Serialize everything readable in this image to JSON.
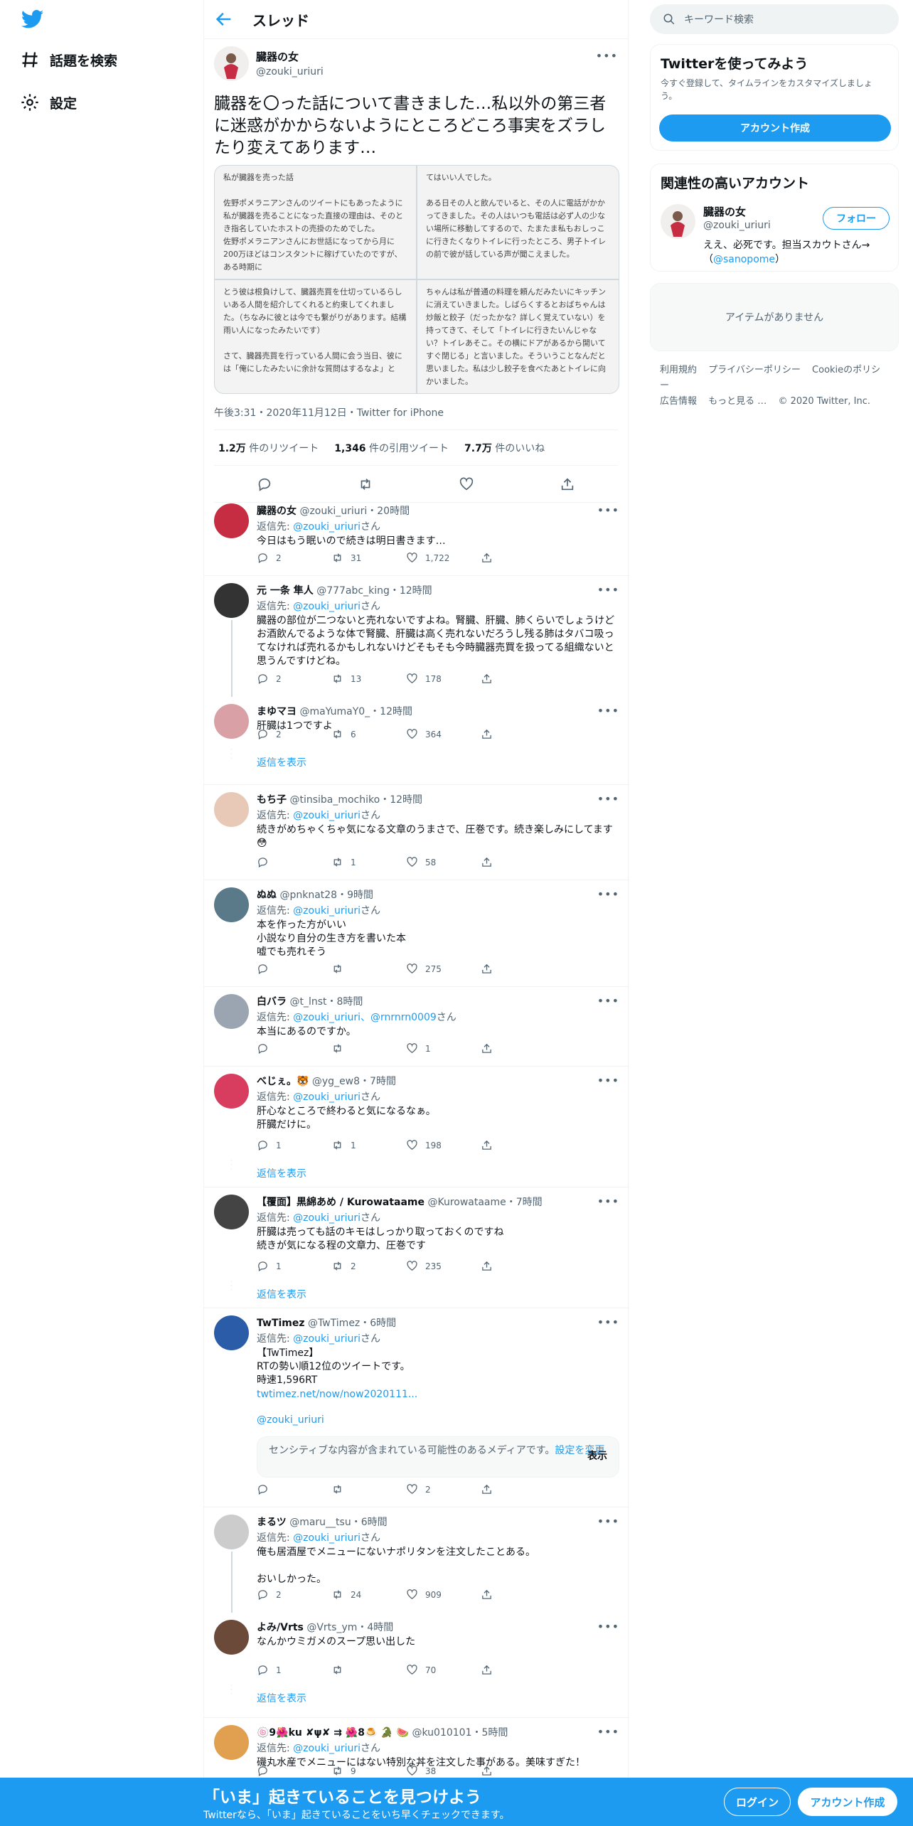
{
  "nav": {
    "explore": "話題を検索",
    "settings": "設定"
  },
  "header": {
    "title": "スレッド"
  },
  "main_tweet": {
    "name": "臓器の女",
    "handle": "@zouki_uriuri",
    "text": "臓器を〇った話について書きました…私以外の第三者に迷惑がかからないようにところどころ事実をズラしたり変えてあります…",
    "panels": [
      "私が臓器を売った話\n\n佐野ポメラニアンさんのツイートにもあったように私が臓器を売ることになった直接の理由は、そのとき指名していたホストの売掛のためでした。\n佐野ポメラニアンさんにお世話になってから月に200万ほどはコンスタントに稼げていたのですが、ある時期に",
      "てはいい人でした。\n\nある日その人と飲んでいると、その人に電話がかかってきました。その人はいつも電話は必ず人の少ない場所に移動してするので、たまたま私もおしっこに行きたくなりトイレに行ったところ、男子トイレの前で彼が話している声が聞こえました。",
      "とう彼は根負けして、臓器売買を仕切っているらしいある人間を紹介してくれると約束してくれました。（ちなみに彼とは今でも繋がりがあります。結構雨い人になったみたいです）\n\nさて、臓器売買を行っている人間に会う当日、彼には「俺にしたみたいに余計な質問はするなよ」と",
      "ちゃんは私が普通の料理を頼んだみたいにキッチンに消えていきました。しばらくするとおばちゃんは炒飯と餃子（だったかな？詳しく覚えていない）を持ってきて、そして「トイレに行きたいんじゃない？トイレあそこ。その横にドアがあるから開いてすぐ閉じる」と言いました。そういうことなんだと思いました。私は少し餃子を食べたあとトイレに向かいました。"
    ],
    "meta": "午後3:31・2020年11月12日・Twitter for iPhone",
    "retweets": "1.2万",
    "retweets_label": "件のリツイート",
    "quotes": "1,346",
    "quotes_label": "件の引用ツイート",
    "likes": "7.7万",
    "likes_label": "件のいいね"
  },
  "replies": [
    {
      "name": "臓器の女",
      "handle": "@zouki_uriuri・20時間",
      "to": "@zouki_uriuri",
      "text": "今日はもう眠いので続きは明日書きます…",
      "reply": "2",
      "rt": "31",
      "like": "1,722"
    },
    {
      "name": "元 一条 隼人",
      "handle": "@777abc_king・12時間",
      "to": "@zouki_uriuri",
      "text": "臓器の部位が二つないと売れないですよね。腎臓、肝臓、肺くらいでしょうけどお酒飲んでるような体で腎臓、肝臓は高く売れないだろうし残る肺はタバコ吸ってなければ売れるかもしれないけどそもそも今時臓器売買を扱ってる組織ないと思うんですけどね。",
      "reply": "2",
      "rt": "13",
      "like": "178"
    },
    {
      "name": "まゆマヨ",
      "handle": "@maYumaY0_・12時間",
      "to": "",
      "text": "肝臓は1つですよ",
      "reply": "2",
      "rt": "6",
      "like": "364"
    },
    {
      "name": "もち子",
      "handle": "@tinsiba_mochiko・12時間",
      "to": "@zouki_uriuri",
      "text": "続きがめちゃくちゃ気になる文章のうまさで、圧巻です。続き楽しみにしてます😳",
      "reply": "",
      "rt": "1",
      "like": "58"
    },
    {
      "name": "ぬぬ",
      "handle": "@pnknat28・9時間",
      "to": "@zouki_uriuri",
      "text": "本を作った方がいい\n小説なり自分の生き方を書いた本\n嘘でも売れそう",
      "reply": "",
      "rt": "",
      "like": "275"
    },
    {
      "name": "白バラ",
      "handle": "@t_lnst・8時間",
      "to": "@zouki_uriuri、@rnrnrn0009",
      "text": "本当にあるのですか。",
      "reply": "",
      "rt": "",
      "like": "1"
    },
    {
      "name": "べじぇ。🐯",
      "handle": "@yg_ew8・7時間",
      "to": "@zouki_uriuri",
      "text": "肝心なところで終わると気になるなぁ。\n肝臓だけに。",
      "reply": "1",
      "rt": "1",
      "like": "198"
    },
    {
      "name": "【覆面】黒綿あめ / Kurowataame",
      "handle": "@Kurowataame・7時間",
      "to": "@zouki_uriuri",
      "text": "肝臓は売っても話のキモはしっかり取っておくのですね\n続きが気になる程の文章力、圧巻です",
      "reply": "1",
      "rt": "2",
      "like": "235"
    },
    {
      "name": "TwTimez",
      "handle": "@TwTimez・6時間",
      "to": "@zouki_uriuri",
      "text": "【TwTimez】\nRTの勢い順12位のツイートです。\n時速1,596RT",
      "link": "twtimez.net/now/now2020111...",
      "mention": "@zouki_uriuri",
      "reply": "",
      "rt": "",
      "like": "2"
    },
    {
      "name": "まるツ",
      "handle": "@maru__tsu・6時間",
      "to": "@zouki_uriuri",
      "text": "俺も居酒屋でメニューにないナポリタンを注文したことある。\n\nおいしかった。",
      "reply": "2",
      "rt": "24",
      "like": "909"
    },
    {
      "name": "よみ/Vrts",
      "handle": "@Vrts_ym・4時間",
      "to": "",
      "text": "なんかウミガメのスープ思い出した",
      "reply": "1",
      "rt": "",
      "like": "70"
    },
    {
      "name": "🍥9🌺ku ✘ψ✘ ⇉ 🌺8🍮 🐊 🍉",
      "handle": "@ku010101・5時間",
      "to": "@zouki_uriuri",
      "text": "磯丸水産でメニューにはない特別な丼を注文した事がある。美味すぎた！",
      "reply": "",
      "rt": "9",
      "like": "38"
    }
  ],
  "reply_to_prefix": "返信先: ",
  "reply_to_suffix": "さん",
  "show_replies": "返信を表示",
  "sensitive": {
    "text": "センシティブな内容が含まれている可能性のあるメディアです。",
    "change": "設定を変更",
    "show": "表示"
  },
  "right": {
    "search_placeholder": "キーワード検索",
    "signup_box": {
      "title": "Twitterを使ってみよう",
      "sub": "今すぐ登録して、タイムラインをカスタマイズしましょう。",
      "button": "アカウント作成"
    },
    "related": {
      "title": "関連性の高いアカウント",
      "name": "臓器の女",
      "handle": "@zouki_uriuri",
      "follow": "フォロー",
      "bio": "ええ、必死です。担当スカウトさん→（",
      "bio_link": "@sanopome",
      "bio_end": "）"
    },
    "empty": "アイテムがありません",
    "footer": [
      "利用規約",
      "プライバシーポリシー",
      "Cookieのポリシー",
      "広告情報",
      "もっと見る …",
      "© 2020 Twitter, Inc."
    ]
  },
  "banner": {
    "headline": "「いま」起きていることを見つけよう",
    "sub": "Twitterなら、「いま」起きていることをいち早くチェックできます。",
    "login": "ログイン",
    "signup": "アカウント作成"
  },
  "colors": {
    "accent": "#1d9bf0",
    "text": "#0f1419",
    "muted": "#536471"
  }
}
